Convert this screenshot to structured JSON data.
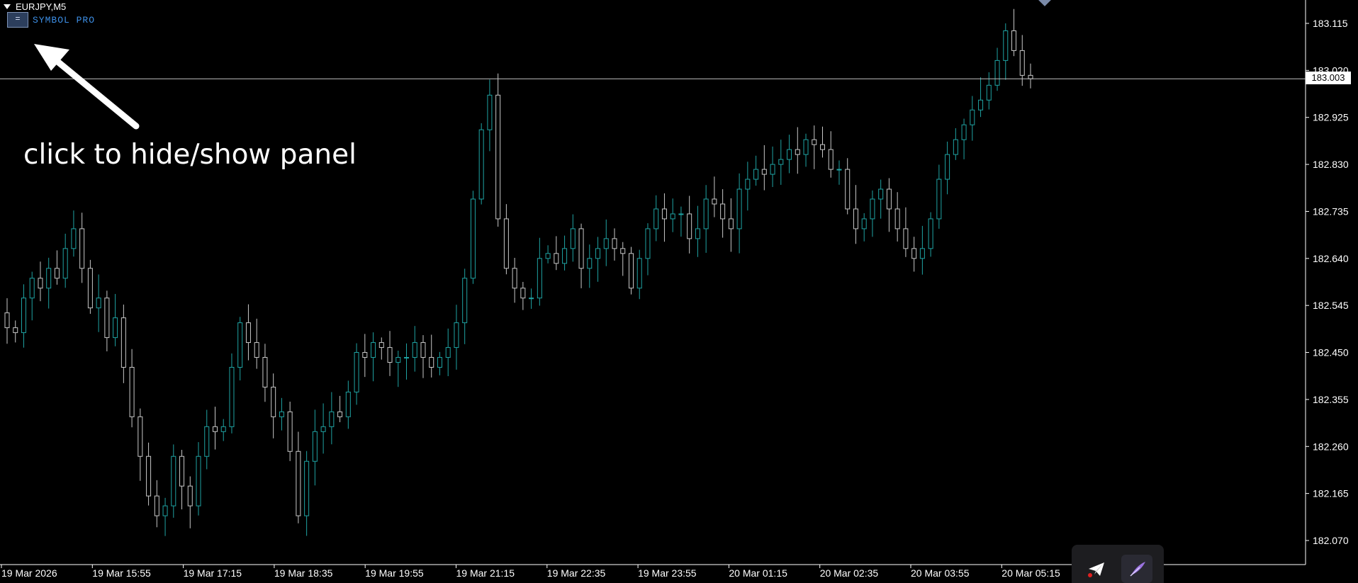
{
  "window": {
    "title": "EURJPY,M5",
    "panel_button_label": "=",
    "panel_name": "SYMBOL PRO"
  },
  "annotation": {
    "text": "click to hide/show panel"
  },
  "current_price": "183.003",
  "colors": {
    "background": "#000000",
    "bull_candle": "#1fa3a3",
    "bear_candle": "#c8c8c8",
    "panel_text": "#3d8fe6",
    "price_line": "#c0c0c0"
  },
  "toolbar": {
    "send_icon": "paper-plane-icon",
    "quill_icon": "quill-icon"
  },
  "chart_data": {
    "type": "candlestick",
    "symbol": "EURJPY",
    "timeframe": "M5",
    "y_ticks": [
      "183.115",
      "183.020",
      "182.925",
      "182.830",
      "182.735",
      "182.640",
      "182.545",
      "182.450",
      "182.355",
      "182.260",
      "182.165",
      "182.070"
    ],
    "ylim": [
      182.03,
      183.145
    ],
    "x_ticks": [
      "19 Mar 2026",
      "19 Mar 15:55",
      "19 Mar 17:15",
      "19 Mar 18:35",
      "19 Mar 19:55",
      "19 Mar 21:15",
      "19 Mar 22:35",
      "19 Mar 23:55",
      "20 Mar 01:15",
      "20 Mar 02:35",
      "20 Mar 03:55",
      "20 Mar 05:15"
    ],
    "closes": [
      182.5,
      182.49,
      182.56,
      182.6,
      182.58,
      182.62,
      182.6,
      182.66,
      182.7,
      182.62,
      182.54,
      182.56,
      182.48,
      182.52,
      182.42,
      182.32,
      182.24,
      182.16,
      182.12,
      182.14,
      182.24,
      182.18,
      182.14,
      182.24,
      182.3,
      182.29,
      182.3,
      182.42,
      182.51,
      182.47,
      182.44,
      182.38,
      182.32,
      182.33,
      182.25,
      182.12,
      182.23,
      182.29,
      182.3,
      182.33,
      182.32,
      182.37,
      182.45,
      182.44,
      182.47,
      182.46,
      182.43,
      182.44,
      182.44,
      182.47,
      182.44,
      182.42,
      182.44,
      182.46,
      182.51,
      182.6,
      182.76,
      182.9,
      182.97,
      182.72,
      182.62,
      182.58,
      182.56,
      182.56,
      182.64,
      182.65,
      182.63,
      182.66,
      182.7,
      182.62,
      182.64,
      182.66,
      182.68,
      182.66,
      182.65,
      182.58,
      182.64,
      182.7,
      182.74,
      182.72,
      182.73,
      182.73,
      182.68,
      182.7,
      182.76,
      182.75,
      182.72,
      182.7,
      182.78,
      182.8,
      182.82,
      182.81,
      182.83,
      182.84,
      182.86,
      182.85,
      182.88,
      182.87,
      182.86,
      182.82,
      182.82,
      182.74,
      182.7,
      182.72,
      182.76,
      182.78,
      182.74,
      182.7,
      182.66,
      182.64,
      182.66,
      182.72,
      182.8,
      182.85,
      182.88,
      182.91,
      182.94,
      182.96,
      182.99,
      183.04,
      183.1,
      183.06,
      183.01,
      183.003
    ]
  }
}
